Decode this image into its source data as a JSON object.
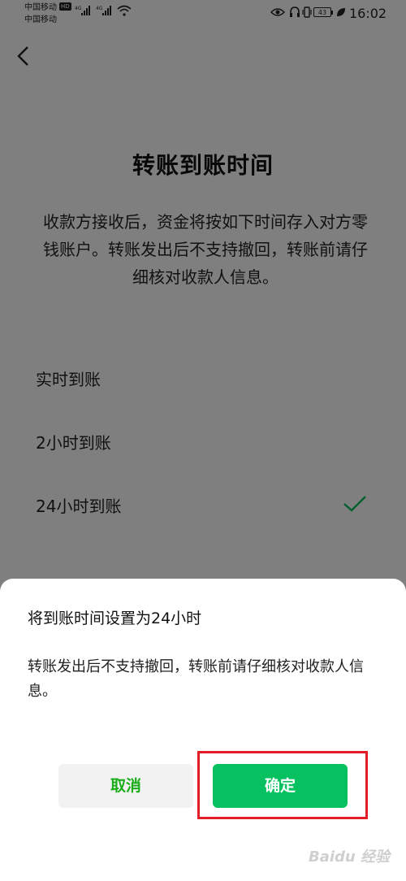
{
  "colors": {
    "accent_green": "#07c160",
    "cancel_text_green": "#1aad19",
    "highlight_red": "#e21d25",
    "overlay": "rgba(0,0,0,0.5)"
  },
  "status_bar": {
    "carrier_1": "中国移动",
    "carrier_2": "中国移动",
    "hd_badge": "HD",
    "battery_level": "43",
    "time": "16:02"
  },
  "page": {
    "title": "转账到账时间",
    "description": "收款方接收后，资金将按如下时间存入对方零钱账户。转账发出后不支持撤回，转账前请仔细核对收款人信息。",
    "options": [
      {
        "label": "实时到账",
        "selected": false
      },
      {
        "label": "2小时到账",
        "selected": false
      },
      {
        "label": "24小时到账",
        "selected": true
      }
    ]
  },
  "dialog": {
    "title": "将到账时间设置为24小时",
    "message": "转账发出后不支持撤回，转账前请仔细核对收款人信息。",
    "cancel_label": "取消",
    "confirm_label": "确定"
  },
  "watermark": "Baidu 经验"
}
